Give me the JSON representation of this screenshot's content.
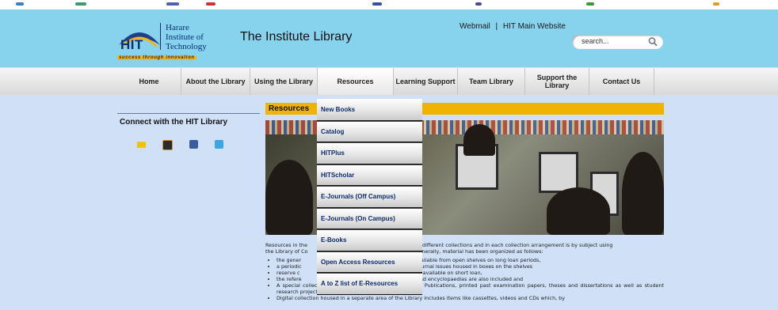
{
  "header": {
    "logo_abbr": "HIT",
    "logo_name_lines": [
      "Harare",
      "Institute of",
      "Technology"
    ],
    "logo_tagline": "success through innovation",
    "site_title": "The Institute Library",
    "links": [
      "Webmail",
      "HIT Main Website"
    ],
    "link_separator": "|",
    "search_placeholder": "search..."
  },
  "nav": {
    "items": [
      "Home",
      "About the Library",
      "Using the Library",
      "Resources",
      "Learning Support",
      "Team Library",
      "Support the Library",
      "Contact Us"
    ]
  },
  "sidebar": {
    "heading": "Connect with the HIT Library",
    "social_icons": [
      "email-icon",
      "rss-icon",
      "facebook-icon",
      "twitter-icon"
    ]
  },
  "content": {
    "section_title": "Resources",
    "paragraph_start": "Resources in the",
    "paragraph_end": "different collections and in each collection arrangement is by subject using",
    "paragraph_line2_start": "the Library of Co",
    "paragraph_line2_end": "enerally, material has been organized as follows:",
    "bullets": [
      {
        "left": "the gener",
        "right": "vailable from open shelves on long loan periods,"
      },
      {
        "left": "a periodic",
        "right": "ournal issues housed in boxes on the shelves"
      },
      {
        "left": "reserve c",
        "right": "d available on short loan,"
      },
      {
        "left": "the refere",
        "right": "s and encyclopaedias are also included and"
      },
      {
        "left": "A special collection currently consisting of Government Publications, printed past examination papers, theses and dissertations as well as student research projects",
        "right": ""
      },
      {
        "left": "Digital collection housed in a separate area of the Library includes items like cassettes, videos and CDs which, by",
        "right": ""
      }
    ]
  },
  "dropdown": {
    "items": [
      "New Books",
      "Catalog",
      "HITPlus",
      "HITScholar",
      "E-Journals (Off Campus)",
      "E-Journals (On Campus)",
      "E-Books",
      "Open Access Resources",
      "A to Z list of E-Resources"
    ]
  },
  "colors": {
    "header_bg": "#87d3ee",
    "page_bg": "#cfe0f7",
    "accent_yellow": "#f0b400",
    "link_blue": "#0c2a6e"
  }
}
